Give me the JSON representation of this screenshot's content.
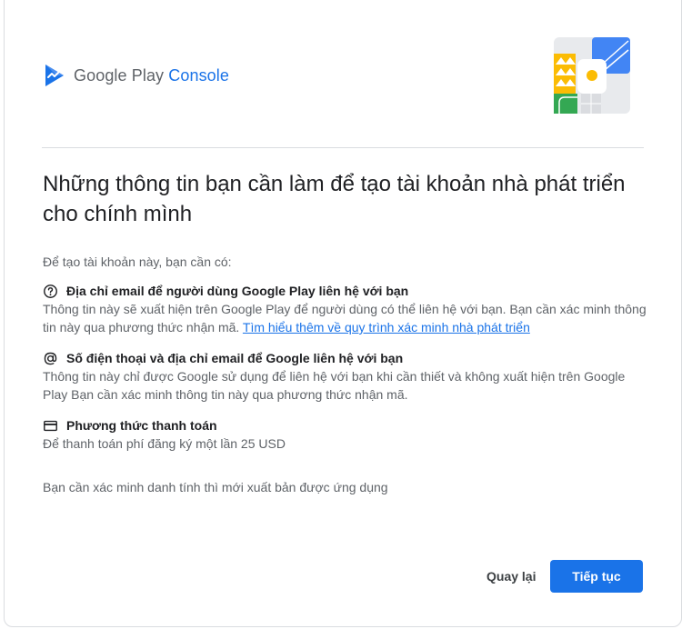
{
  "brand": {
    "name_part1": "Google Play ",
    "name_part2": "Console",
    "logo_icon": "play-console-logo-icon",
    "accent_color": "#1a73e8"
  },
  "header": {
    "illustration": "play-console-illustration"
  },
  "main": {
    "title": "Những thông tin bạn cần làm để tạo tài khoản nhà phát triển cho chính mình",
    "intro": "Để tạo tài khoản này, bạn cần có:",
    "requirements": [
      {
        "icon": "help-circle-icon",
        "title": "Địa chỉ email để người dùng Google Play liên hệ với bạn",
        "description": "Thông tin này sẽ xuất hiện trên Google Play để người dùng có thể liên hệ với bạn. Bạn cần xác minh thông tin này qua phương thức nhận mã. ",
        "link_text": "Tìm hiểu thêm về quy trình xác minh nhà phát triển"
      },
      {
        "icon": "at-sign-icon",
        "title": "Số điện thoại và địa chỉ email để Google liên hệ với bạn",
        "description": "Thông tin này chỉ được Google sử dụng để liên hệ với bạn khi cần thiết và không xuất hiện trên Google Play Bạn cần xác minh thông tin này qua phương thức nhận mã."
      },
      {
        "icon": "credit-card-icon",
        "title": "Phương thức thanh toán",
        "description": "Để thanh toán phí đăng ký một lần 25 USD"
      }
    ],
    "note": "Bạn cần xác minh danh tính thì mới xuất bản được ứng dụng"
  },
  "actions": {
    "back_label": "Quay lại",
    "next_label": "Tiếp tục"
  }
}
